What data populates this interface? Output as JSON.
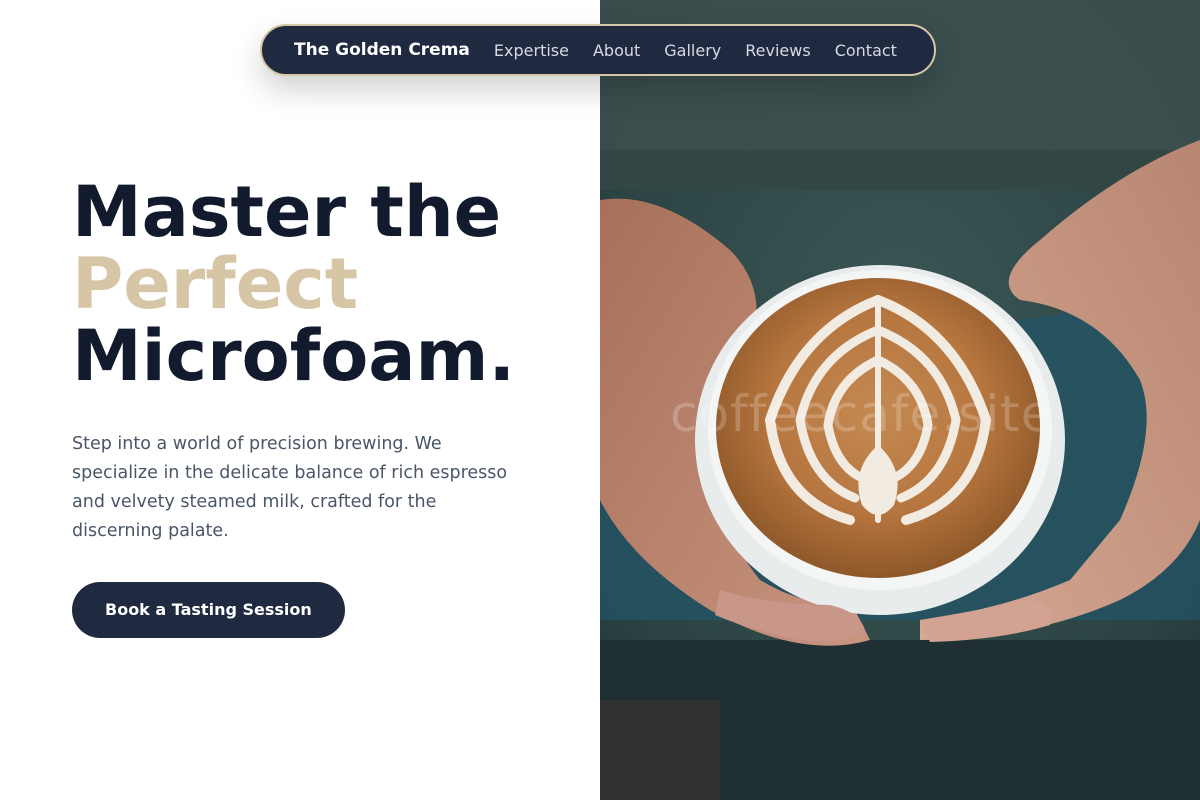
{
  "nav": {
    "brand": "The Golden Crema",
    "links": [
      "Expertise",
      "About",
      "Gallery",
      "Reviews",
      "Contact"
    ]
  },
  "hero": {
    "headline_line1": "Master the",
    "headline_line2": "Perfect",
    "headline_line3": "Microfoam.",
    "description": "Step into a world of precision brewing. We specialize in the delicate balance of rich espresso and velvety steamed milk, crafted for the discerning palate.",
    "cta_label": "Book a Tasting Session",
    "image_icon": "latte-art-photo",
    "watermark": "coffeecafe.site"
  },
  "colors": {
    "navy": "#1f2940",
    "headline": "#121a2e",
    "accent_gold": "#d6c6a6",
    "body_text": "#4a5668"
  }
}
